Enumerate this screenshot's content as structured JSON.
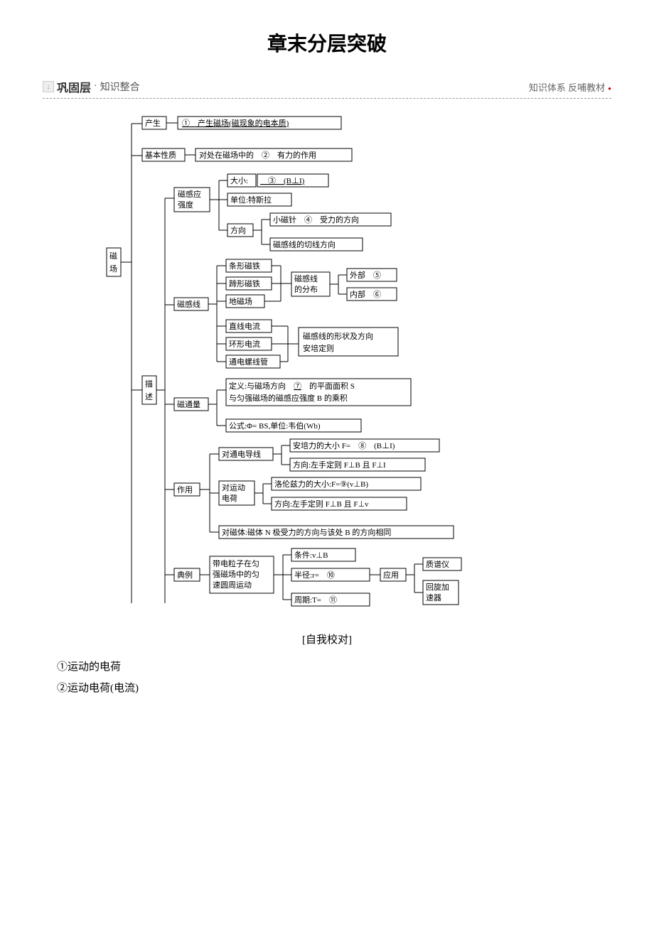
{
  "title": "章末分层突破",
  "section": {
    "main": "巩固层",
    "sep": "·",
    "sub": "知识整合",
    "right": "知识体系  反哺教材"
  },
  "root": "磁场",
  "n": {
    "produce": "产生",
    "produce_line": "①　产生磁场(磁现象的电本质)",
    "basic": "基本性质",
    "basic_line": "对处在磁场中的　②　有力的作用",
    "desc": "描述",
    "mfi": "磁感应强度",
    "mfi_size": "大小:",
    "mfi_size_val": "　③　(B⊥I)",
    "mfi_unit": "单位:特斯拉",
    "mfi_dir": "方向",
    "mfi_dir_needle": "小磁针　④　受力的方向",
    "mfi_dir_tan": "磁感线的切线方向",
    "mfl": "磁感线",
    "bar": "条形磁铁",
    "horse": "蹄形磁铁",
    "earth": "地磁场",
    "dist": "磁感线的分布",
    "outer": "外部　⑤",
    "inner": "内部　⑥",
    "line_i": "直线电流",
    "ring_i": "环形电流",
    "sol": "通电螺线管",
    "shape_a": "磁感线的形状及方向",
    "shape_b": "安培定则",
    "flux": "磁通量",
    "flux_def": "定义:与磁场方向　⑦　的平面面积 S\n与匀强磁场的磁感应强度 B 的乘积",
    "flux_formula": "公式:Φ= BS,单位:韦伯(Wb)",
    "effect": "作用",
    "wire": "对通电导线",
    "amp": "安培力的大小 F=　⑧　(B⊥I)",
    "amp_dir": "方向:左手定则 F⊥B 且 F⊥I",
    "charge": "对运动电荷",
    "lor": "洛伦兹力的大小:F=⑨(v⊥B)",
    "lor_dir": "方向:左手定则 F⊥B 且 F⊥v",
    "mag_body": "对磁体:磁体 N 极受力的方向与该处 B 的方向相同",
    "example": "典例",
    "circ": "带电粒子在匀强磁场中的匀速圆周运动",
    "cond": "条件:v⊥B",
    "radius": "半径:r=　⑩",
    "period": "周期:T=　⑪",
    "app": "应用",
    "spec": "质谱仪",
    "cyc": "回旋加速器"
  },
  "caption": "[自我校对]",
  "answers": [
    "①运动的电荷",
    "②运动电荷(电流)"
  ]
}
